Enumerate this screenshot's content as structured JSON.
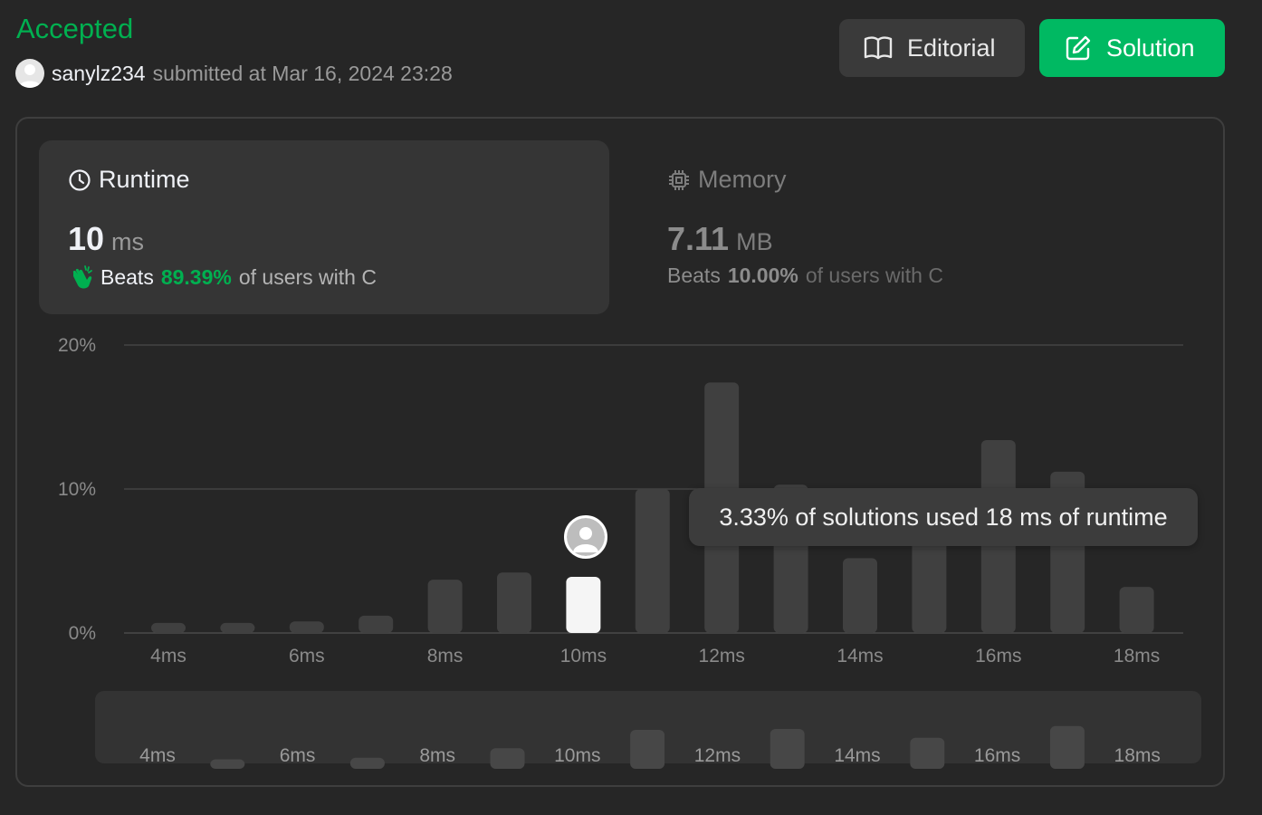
{
  "header": {
    "status": "Accepted",
    "username": "sanylz234",
    "submitted_text": "submitted at Mar 16, 2024 23:28"
  },
  "buttons": {
    "editorial": "Editorial",
    "solution": "Solution"
  },
  "runtime": {
    "label": "Runtime",
    "value": "10",
    "unit": "ms",
    "beats_label": "Beats",
    "beats_pct": "89.39%",
    "beats_suffix": "of users with C"
  },
  "memory": {
    "label": "Memory",
    "value": "7.11",
    "unit": "MB",
    "beats_label": "Beats",
    "beats_pct": "10.00%",
    "beats_suffix": "of users with C"
  },
  "tooltip": "3.33% of solutions used 18 ms of runtime",
  "colors": {
    "accent_green": "#00b050",
    "solution_button": "#00b962",
    "bar": "#404040",
    "bar_selected": "#f5f5f5"
  },
  "chart_data": {
    "type": "bar",
    "xlabel": "",
    "ylabel": "",
    "ylim": [
      0,
      20
    ],
    "y_ticks": [
      "0%",
      "10%",
      "20%"
    ],
    "x_ticks": [
      "4ms",
      "6ms",
      "8ms",
      "10ms",
      "12ms",
      "14ms",
      "16ms",
      "18ms"
    ],
    "grid": true,
    "categories": [
      "4ms",
      "5ms",
      "6ms",
      "7ms",
      "8ms",
      "9ms",
      "10ms",
      "11ms",
      "12ms",
      "13ms",
      "14ms",
      "15ms",
      "16ms",
      "17ms",
      "18ms"
    ],
    "values": [
      0.7,
      0.7,
      0.8,
      1.2,
      3.7,
      4.2,
      3.9,
      10.0,
      17.4,
      10.3,
      5.2,
      7.5,
      13.4,
      11.2,
      3.2
    ],
    "selected_category": "10ms",
    "overview": {
      "x_ticks": [
        "4ms",
        "6ms",
        "8ms",
        "10ms",
        "12ms",
        "14ms",
        "16ms",
        "18ms"
      ]
    }
  }
}
